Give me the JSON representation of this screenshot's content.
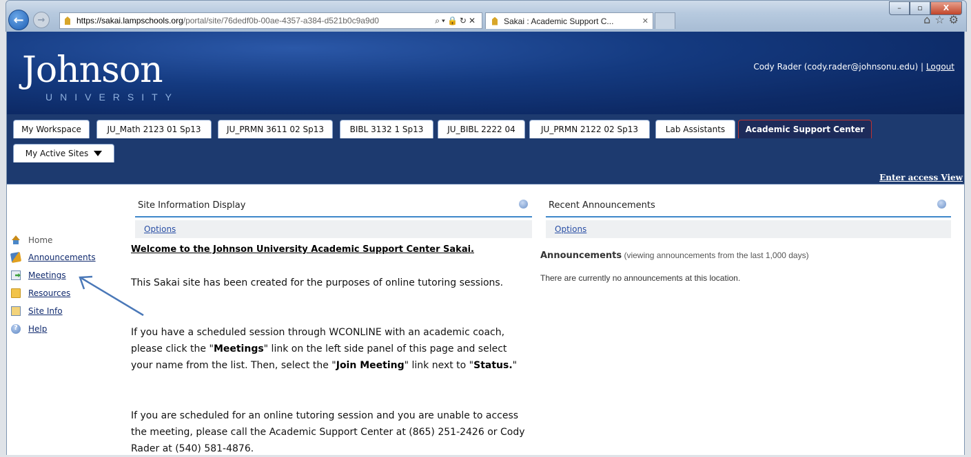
{
  "browser": {
    "url_host": "https://sakai.lampschools.org",
    "url_path": "/portal/site/76dedf0b-00ae-4357-a384-d521b0c9a9d0",
    "tab_title": "Sakai : Academic Support C...",
    "win_min": "–",
    "win_max": "▫",
    "win_close": "X"
  },
  "header": {
    "logo_word": "Johnson",
    "logo_sub": "UNIVERSITY",
    "user": "Cody Rader (cody.rader@johnsonu.edu)",
    "separator": "|",
    "logout": "Logout"
  },
  "site_tabs": [
    "My Workspace",
    "JU_Math 2123 01 Sp13",
    "JU_PRMN 3611 02 Sp13",
    "BIBL 3132 1 Sp13",
    "JU_BIBL 2222 04",
    "JU_PRMN 2122 02 Sp13",
    "Lab Assistants",
    "Academic Support Center"
  ],
  "active_sites": "My Active Sites",
  "enter_view": "Enter access View",
  "nav": {
    "home": "Home",
    "announcements": "Announcements",
    "meetings": "Meetings",
    "resources": "Resources",
    "site_info": "Site Info",
    "help": "Help"
  },
  "site_info": {
    "title": "Site Information Display",
    "options": "Options",
    "welcome": "Welcome to the Johnson University Academic Support Center Sakai.",
    "p1": "This Sakai site has been created for the purposes of online tutoring sessions.",
    "p2_a": "If you have a scheduled session through WCONLINE with an academic coach, please click the \"",
    "p2_meetings": "Meetings",
    "p2_b": "\" link on the left side panel of this page and select your name from the list. Then, select the \"",
    "p2_join": "Join Meeting",
    "p2_c": "\" link next to \"",
    "p2_status": "Status.",
    "p2_d": "\"",
    "p3": "If you are scheduled for an online tutoring session and you are unable to access the meeting, please call the Academic Support Center at (865) 251-2426 or Cody Rader at (540) 581-4876."
  },
  "announcements": {
    "title": "Recent Announcements",
    "options": "Options",
    "heading": "Announcements",
    "sub": "(viewing announcements from the last 1,000 days)",
    "empty": "There are currently no announcements at this location."
  }
}
